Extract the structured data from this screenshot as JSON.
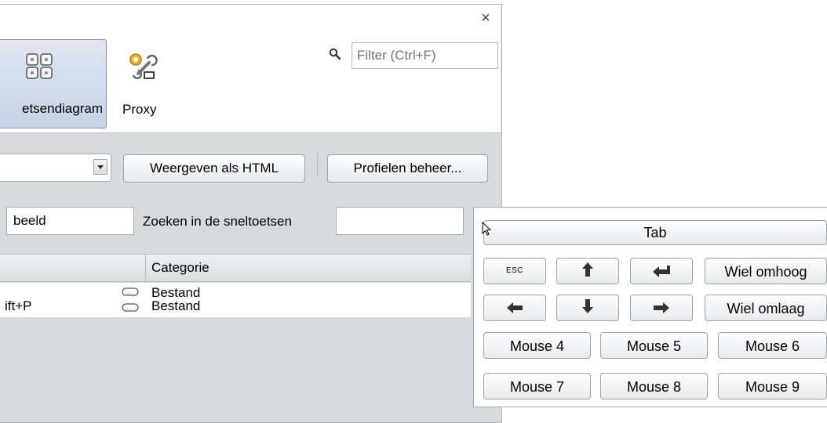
{
  "window": {
    "close_glyph": "×"
  },
  "toolbar": {
    "items": [
      {
        "label": "etsendiagram",
        "icon": "keyboard-icon",
        "selected": true
      },
      {
        "label": "Proxy",
        "icon": "tools-icon",
        "selected": false
      }
    ],
    "filter_placeholder": "Filter (Ctrl+F)"
  },
  "controls": {
    "combo_value": "",
    "html_button": "Weergeven als HTML",
    "profiles_button": "Profielen beheer..."
  },
  "search": {
    "left_value": "beeld",
    "shortcut_label": "Zoeken in de sneltoetsen",
    "shortcut_value": ""
  },
  "table": {
    "headers": [
      "",
      "Categorie"
    ],
    "rows": [
      {
        "shortcut": "",
        "category": "Bestand"
      },
      {
        "shortcut": "ift+P",
        "category": "Bestand"
      }
    ]
  },
  "keyboard_popup": {
    "tab_label": "Tab",
    "esc_label": "ESC",
    "wheel_up": "Wiel omhoog",
    "wheel_down": "Wiel omlaag",
    "mouse_buttons": [
      "Mouse 4",
      "Mouse 5",
      "Mouse 6",
      "Mouse 7",
      "Mouse 8",
      "Mouse 9"
    ]
  },
  "colors": {
    "selected_tool": "#c6d3e6",
    "dialog_bg": "#d9dadd"
  }
}
